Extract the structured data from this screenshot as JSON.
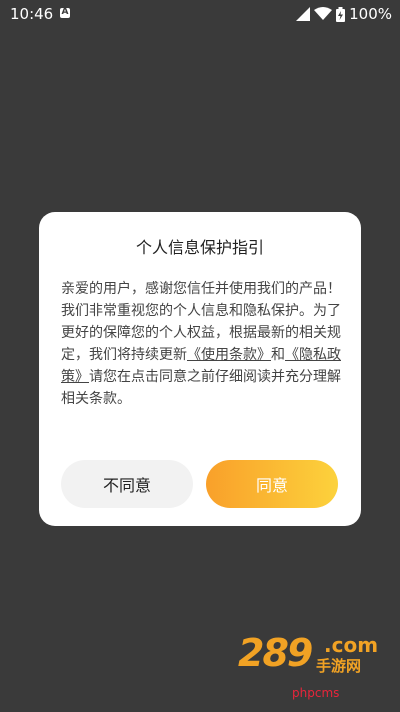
{
  "status_bar": {
    "time": "10:46",
    "battery": "100%"
  },
  "dialog": {
    "title": "个人信息保护指引",
    "body_prefix": "亲爱的用户，感谢您信任并使用我们的产品！我们非常重视您的个人信息和隐私保护。为了更好的保障您的个人权益，根据最新的相关规定，我们将持续更新",
    "terms_link": "《使用条款》",
    "connector": "和",
    "privacy_link": "《隐私政策》",
    "body_suffix": "请您在点击同意之前仔细阅读并充分理解相关条款。",
    "disagree_label": "不同意",
    "agree_label": "同意"
  },
  "watermark": {
    "main": "289",
    "com": ".com",
    "sub": "手游网",
    "site": "phpcms"
  },
  "colors": {
    "agree_gradient_start": "#f9a02a",
    "agree_gradient_end": "#fcd23c",
    "backdrop": "#3a3a3a"
  }
}
